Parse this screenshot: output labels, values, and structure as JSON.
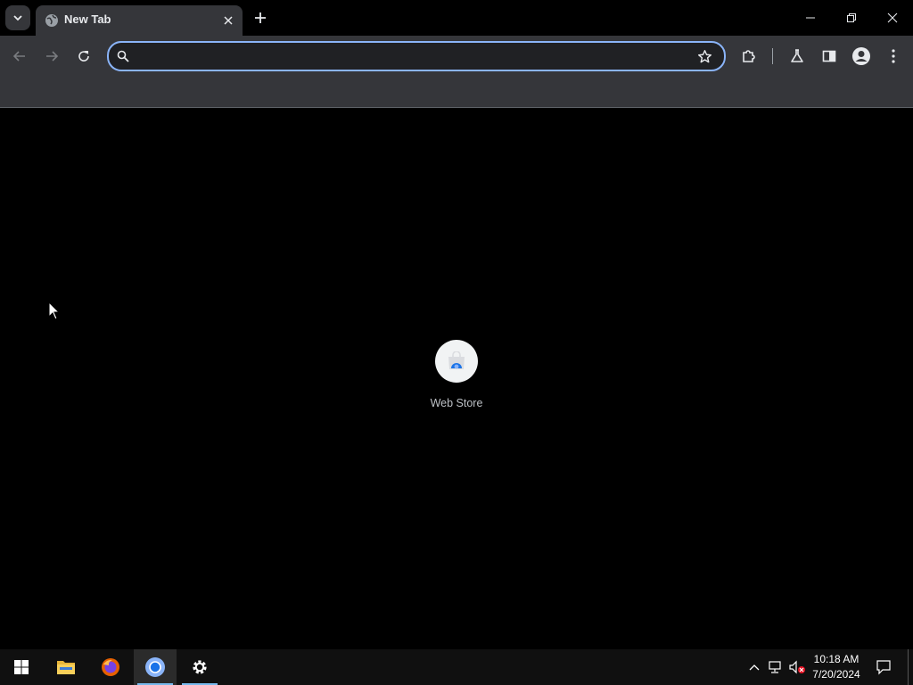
{
  "browser": {
    "tab": {
      "title": "New Tab"
    },
    "omnibox": {
      "value": "",
      "placeholder": ""
    }
  },
  "page": {
    "shortcuts": [
      {
        "label": "Web Store"
      }
    ]
  },
  "taskbar": {
    "apps": [
      "start",
      "file-explorer",
      "firefox",
      "chrome",
      "settings"
    ],
    "clock": {
      "time": "10:18 AM",
      "date": "7/20/2024"
    }
  },
  "colors": {
    "tab_active": "#35363a",
    "toolbar": "#35363a",
    "omnibox_focus": "#8ab4f8",
    "taskbar": "#101010",
    "accent": "#76b9ed"
  }
}
